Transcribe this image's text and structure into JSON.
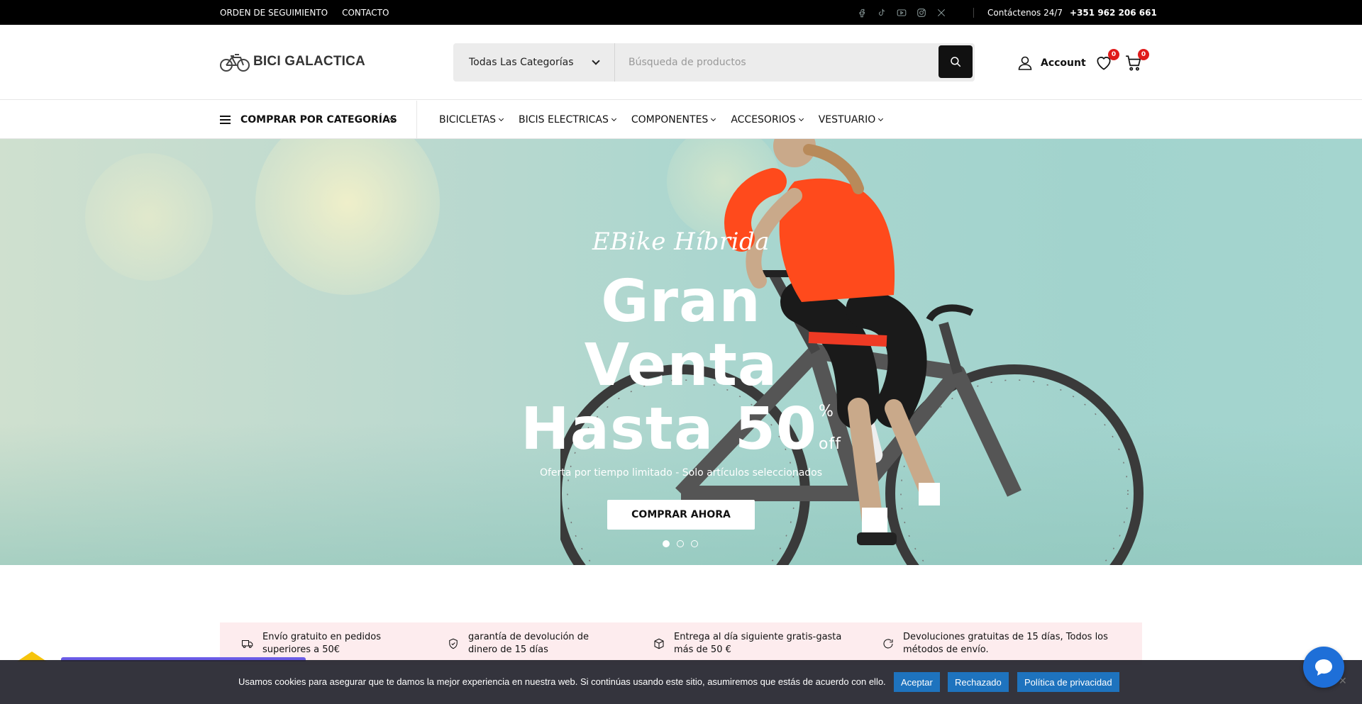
{
  "topbar": {
    "links": [
      "ORDEN DE SEGUIMIENTO",
      "CONTACTO"
    ],
    "social_icons": [
      "facebook-icon",
      "tiktok-icon",
      "youtube-icon",
      "instagram-icon",
      "x-icon"
    ],
    "contact_label": "Contáctenos 24/7",
    "phone": "+351 962 206 661"
  },
  "header": {
    "logo_text": "BICI GALACTICA",
    "search": {
      "category": "Todas Las Categorías",
      "placeholder": "Búsqueda de productos"
    },
    "account_label": "Account",
    "wishlist_count": "0",
    "cart_count": "0"
  },
  "nav": {
    "shop_by_categories": "COMPRAR POR CATEGORÍAS",
    "items": [
      {
        "label": "BICICLETAS"
      },
      {
        "label": "BICIS ELECTRICAS"
      },
      {
        "label": "COMPONENTES"
      },
      {
        "label": "ACCESORIOS"
      },
      {
        "label": "VESTUARIO"
      }
    ]
  },
  "hero": {
    "script_title": "EBike Híbrida",
    "line1": "Gran Venta",
    "line2": "Hasta 50",
    "percent": "%",
    "off": "off",
    "subtitle": "Oferta por tiempo limitado - Solo artículos seleccionados",
    "cta": "COMPRAR AHORA",
    "slides": 3,
    "active_slide": 1
  },
  "features": [
    {
      "icon": "truck-icon",
      "text": "Envío gratuito en pedidos superiores a 50€"
    },
    {
      "icon": "shield-check-icon",
      "text": "garantía de devolución de dinero de 15 días"
    },
    {
      "icon": "box-icon",
      "text": "Entrega al día siguiente gratis-gasta más de 50 €"
    },
    {
      "icon": "refresh-icon",
      "text": "Devoluciones gratuitas de 15 días, Todos los métodos de envío."
    }
  ],
  "cookie": {
    "message": "Usamos cookies para asegurar que te damos la mejor experiencia en nuestra web. Si continúas usando este sitio, asumiremos que estás de acuerdo con ello.",
    "accept": "Aceptar",
    "reject": "Rechazado",
    "privacy": "Política de privacidad",
    "close": "✕"
  },
  "colors": {
    "accent": "#111111",
    "badge": "#e01b1b",
    "cookie_button": "#1e73be",
    "features_bg": "#fdecee",
    "chat": "#1e6fd8"
  }
}
